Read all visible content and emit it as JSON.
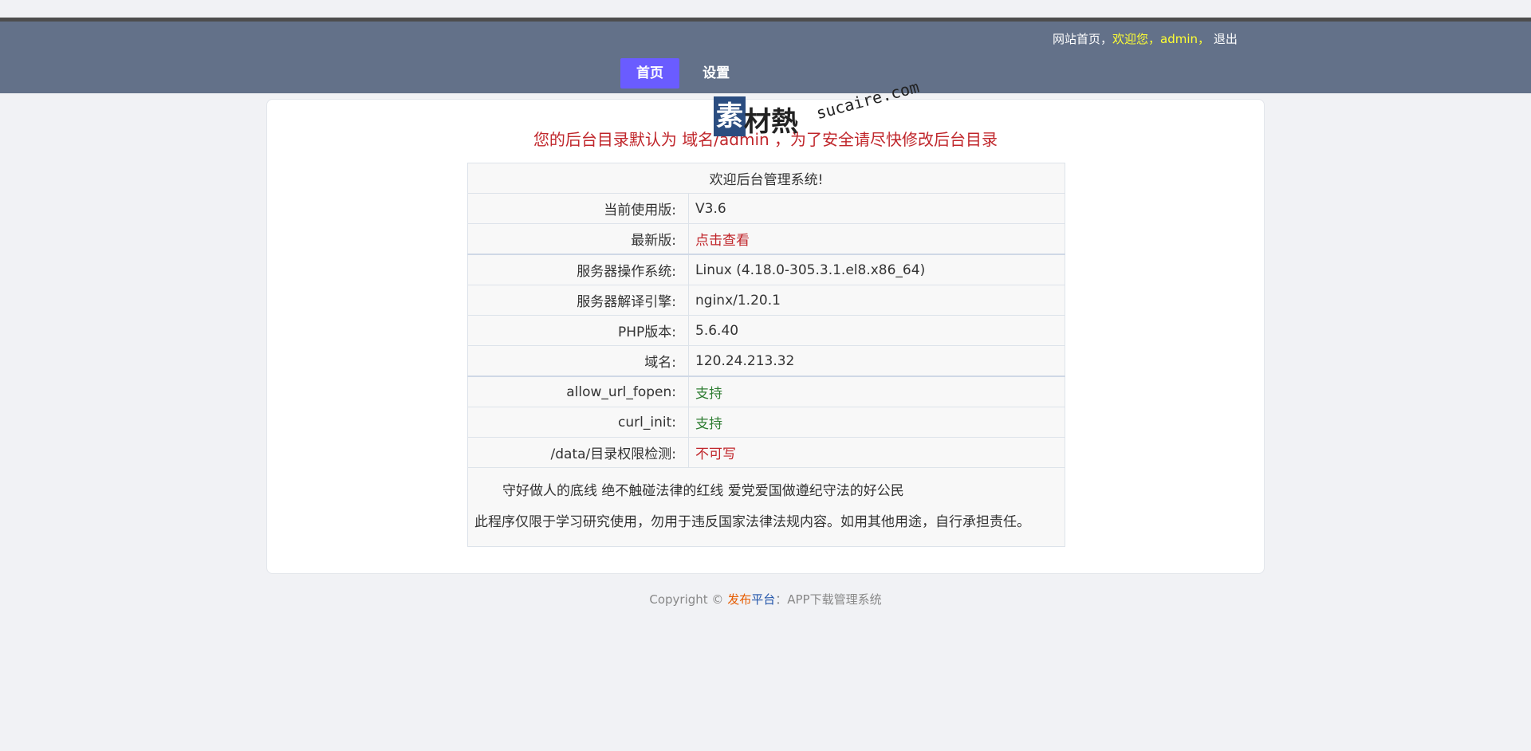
{
  "header": {
    "site_home": "网站首页，",
    "welcome": "欢迎您，admin，",
    "logout": "退出",
    "nav": [
      "首页",
      "设置"
    ]
  },
  "notice": "您的后台目录默认为 域名/admin ，为了安全请尽快修改后台目录",
  "watermark": {
    "mark": "素",
    "text": "材熱",
    "url": "sucaire.com"
  },
  "table": {
    "title": "欢迎后台管理系统!",
    "rows": [
      {
        "label": "当前使用版:",
        "value": "V3.6"
      },
      {
        "label": "最新版:",
        "value": "点击查看"
      },
      {
        "label": "服务器操作系统:",
        "value": "Linux (4.18.0-305.3.1.el8.x86_64)"
      },
      {
        "label": "服务器解译引擎:",
        "value": "nginx/1.20.1"
      },
      {
        "label": "PHP版本:",
        "value": "5.6.40"
      },
      {
        "label": "域名:",
        "value": "120.24.213.32"
      },
      {
        "label": "allow_url_fopen:",
        "value": "支持"
      },
      {
        "label": "curl_init:",
        "value": "支持"
      },
      {
        "label": "/data/目录权限检测:",
        "value": "不可写"
      }
    ],
    "footer_line1": "守好做人的底线 绝不触碰法律的红线 爱党爱国做遵纪守法的好公民",
    "footer_line2": "此程序仅限于学习研究使用，勿用于违反国家法律法规内容。如用其他用途，自行承担责任。"
  },
  "footer": {
    "copyright": "Copyright © ",
    "brand1": "发布",
    "brand2": "平台",
    "rest": "：APP下载管理系统"
  },
  "colors": {
    "header_bg": "#637189",
    "nav_active": "#6a5cff",
    "alert_red": "#c0262b",
    "ok_green": "#2e7d32"
  }
}
